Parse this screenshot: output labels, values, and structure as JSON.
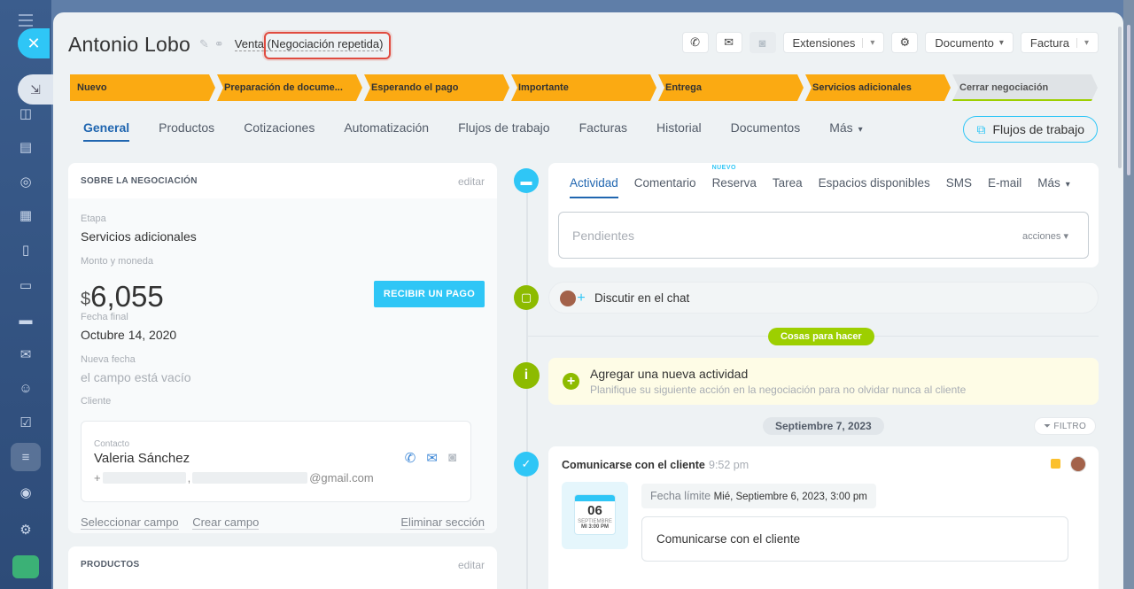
{
  "deal": {
    "title": "Antonio Lobo",
    "type_prefix": "Venta ",
    "type_highlight": "(Negociación repetida)"
  },
  "toolbar": {
    "extensions": "Extensiones",
    "document": "Documento",
    "invoice": "Factura"
  },
  "stages": [
    "Nuevo",
    "Preparación de docume...",
    "Esperando el pago",
    "Importante",
    "Entrega",
    "Servicios adicionales",
    "Cerrar negociación"
  ],
  "tabs": [
    "General",
    "Productos",
    "Cotizaciones",
    "Automatización",
    "Flujos de trabajo",
    "Facturas",
    "Historial",
    "Documentos",
    "Más"
  ],
  "workflows_button": "Flujos de trabajo",
  "about": {
    "heading": "SOBRE LA NEGOCIACIÓN",
    "edit": "editar",
    "stage_label": "Etapa",
    "stage_value": "Servicios adicionales",
    "amount_label": "Monto y moneda",
    "currency": "$",
    "amount": "6,055",
    "pay_button": "RECIBIR UN PAGO",
    "end_date_label": "Fecha final",
    "end_date_value": "Octubre 14, 2020",
    "new_date_label": "Nueva fecha",
    "new_date_value": "el campo está vacío",
    "client_label": "Cliente",
    "contact_label": "Contacto",
    "contact_name": "Valeria Sánchez",
    "contact_phone_prefix": "+",
    "contact_email_suffix": "@gmail.com",
    "select_field": "Seleccionar campo",
    "create_field": "Crear campo",
    "delete_section": "Eliminar sección"
  },
  "products": {
    "heading": "PRODUCTOS",
    "edit": "editar"
  },
  "activity": {
    "tabs": [
      "Actividad",
      "Comentario",
      "Reserva",
      "Tarea",
      "Espacios disponibles",
      "SMS",
      "E-mail",
      "Más"
    ],
    "new_badge": "NUEVO",
    "pending_placeholder": "Pendientes",
    "actions_label": "acciones"
  },
  "chat": {
    "text": "Discutir en el chat"
  },
  "todo_label": "Cosas para hacer",
  "add_activity": {
    "title": "Agregar una nueva actividad",
    "subtitle": "Planifique su siguiente acción en la negociación para no olvidar nunca al cliente"
  },
  "date_separator": "Septiembre 7, 2023",
  "filter_label": "FILTRO",
  "task": {
    "title": "Comunicarse con el cliente",
    "time": "9:52 pm",
    "cal_day": "06",
    "cal_month": "SEPTIEMBRE",
    "cal_weekday_time": "MI 3:00 PM",
    "deadline_label": "Fecha límite ",
    "deadline_value": "Mié, Septiembre 6, 2023, 3:00 pm",
    "description": "Comunicarse con el cliente"
  }
}
